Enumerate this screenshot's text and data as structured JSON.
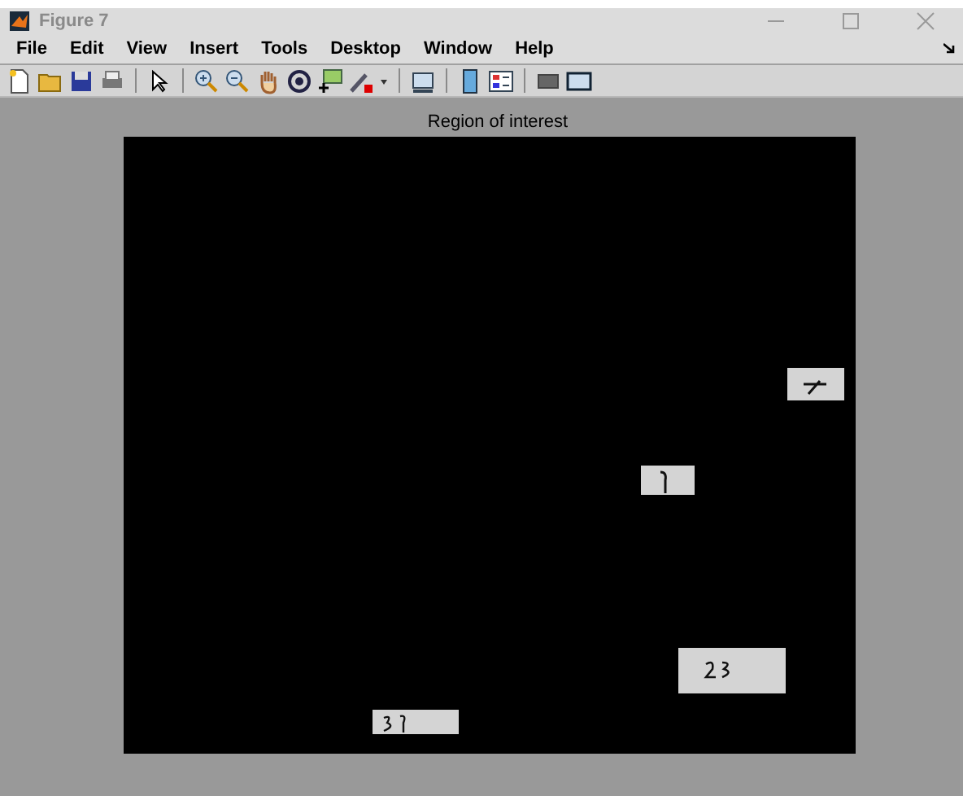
{
  "window": {
    "title": "Figure 7"
  },
  "menu": [
    "File",
    "Edit",
    "View",
    "Insert",
    "Tools",
    "Desktop",
    "Window",
    "Help"
  ],
  "axes": {
    "title": "Region of interest"
  }
}
